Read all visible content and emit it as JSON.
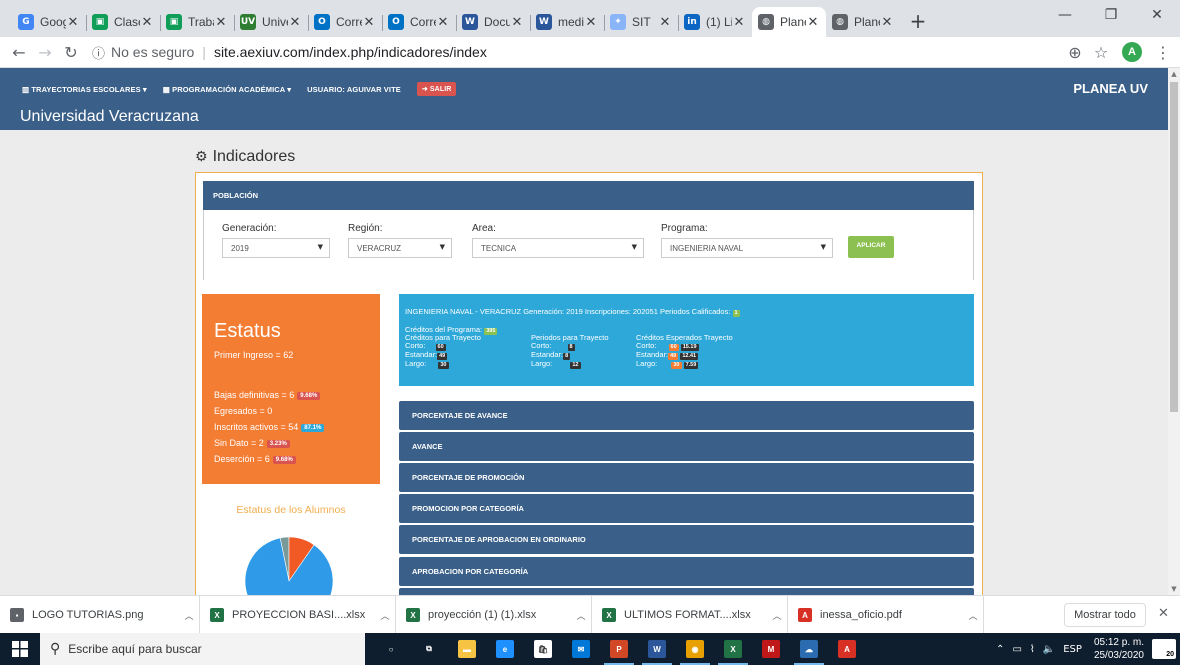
{
  "browser": {
    "tabs": [
      {
        "title": "Goog",
        "icon": "google-icon",
        "color": "#4285f4",
        "glyph": "G",
        "active": false
      },
      {
        "title": "Clase",
        "icon": "classroom-icon",
        "color": "#0f9d58",
        "glyph": "▣",
        "active": false
      },
      {
        "title": "Traba",
        "icon": "classroom-icon",
        "color": "#0f9d58",
        "glyph": "▣",
        "active": false
      },
      {
        "title": "Unive",
        "icon": "uv-icon",
        "color": "#2e7d32",
        "glyph": "UV",
        "active": false
      },
      {
        "title": "Corre",
        "icon": "outlook-icon",
        "color": "#0072c6",
        "glyph": "O",
        "active": false
      },
      {
        "title": "Corre",
        "icon": "outlook-icon",
        "color": "#0072c6",
        "glyph": "O",
        "active": false
      },
      {
        "title": "Docu",
        "icon": "word-icon",
        "color": "#2b579a",
        "glyph": "W",
        "active": false
      },
      {
        "title": "medi",
        "icon": "word-icon",
        "color": "#2b579a",
        "glyph": "W",
        "active": false
      },
      {
        "title": "SIT",
        "icon": "sit-icon",
        "color": "#8ab4f8",
        "glyph": "✦",
        "active": false
      },
      {
        "title": "(1) Lir",
        "icon": "linkedin-icon",
        "color": "#0a66c2",
        "glyph": "in",
        "active": false
      },
      {
        "title": "Plane",
        "icon": "globe-icon",
        "color": "#5f6368",
        "glyph": "◍",
        "active": true
      },
      {
        "title": "Plane",
        "icon": "globe-icon",
        "color": "#5f6368",
        "glyph": "◍",
        "active": false
      }
    ],
    "security_label": "No es seguro",
    "url": "site.aexiuv.com/index.php/indicadores/index",
    "profile_initial": "A"
  },
  "site": {
    "nav": {
      "trayectorias": "TRAYECTORIAS ESCOLARES",
      "programacion": "PROGRAMACIÓN ACADÉMICA",
      "usuario": "USUARIO: AGUIVAR VITE",
      "salir": "SALIR"
    },
    "title": "Universidad Veracruzana",
    "brand": "PLANEA UV"
  },
  "page": {
    "heading": "Indicadores",
    "poblacion_label": "POBLACIÓN",
    "filters": {
      "generacion_label": "Generación:",
      "generacion_value": "2019",
      "region_label": "Región:",
      "region_value": "VERACRUZ",
      "area_label": "Area:",
      "area_value": "TECNICA",
      "programa_label": "Programa:",
      "programa_value": "INGENIERIA NAVAL",
      "apply_label": "APLICAR"
    },
    "estatus": {
      "title": "Estatus",
      "primer_ingreso": "Primer Ingreso = 62",
      "bajas": "Bajas definitivas = 6",
      "bajas_pct": "9.68%",
      "egresados": "Egresados = 0",
      "inscritos": "Inscritos activos = 54",
      "inscritos_pct": "87.1%",
      "sin_dato": "Sin Dato = 2",
      "sin_dato_pct": "3.23%",
      "desercion": "Deserción = 6",
      "desercion_pct": "9.68%"
    },
    "alumnos_title": "Estatus de los Alumnos",
    "info": {
      "title": "INGENIERIA NAVAL - VERACRUZ Generación: 2019  Inscripciones: 202051  Periodos Calificados:",
      "periodos_calificados": "1",
      "creditos_programa_label": "Créditos del Programa:",
      "creditos_programa": "395",
      "creditos_trayecto_label": "Créditos para Trayecto",
      "periodos_trayecto_label": "Periodos para Trayecto",
      "creditos_esperados_label": "Créditos Esperados Trayecto",
      "corto": "Corto:",
      "estandar": "Estandar:",
      "largo": "Largo:",
      "ct_corto": "60",
      "ct_estandar": "49",
      "ct_largo": "30",
      "pt_corto": "8",
      "pt_estandar": "8",
      "pt_largo": "12",
      "ce_corto_a": "60",
      "ce_corto_b": "15.19",
      "ce_estandar_a": "49",
      "ce_estandar_b": "12.41",
      "ce_largo_a": "30",
      "ce_largo_b": "7.59"
    },
    "sections": [
      "PORCENTAJE DE AVANCE",
      "AVANCE",
      "PORCENTAJE DE PROMOCIÓN",
      "PROMOCION POR CATEGORÍA",
      "PORCENTAJE DE APROBACION EN ORDINARIO",
      "APROBACION POR CATEGORÍA"
    ]
  },
  "chart_data": {
    "type": "pie",
    "slices": [
      {
        "category": "Inscritos activos",
        "value": 87.1,
        "color": "#2e9ae8"
      },
      {
        "category": "Bajas definitivas",
        "value": 9.68,
        "color": "#f15a24"
      },
      {
        "category": "Sin Dato",
        "value": 3.23,
        "color": "#7a9a9a"
      }
    ]
  },
  "downloads": {
    "items": [
      {
        "name": "LOGO TUTORIAS.png",
        "icon": "image-file-icon",
        "color": "#5f6368",
        "glyph": "▪"
      },
      {
        "name": "PROYECCION BASI....xlsx",
        "icon": "excel-file-icon",
        "color": "#217346",
        "glyph": "X"
      },
      {
        "name": "proyección (1) (1).xlsx",
        "icon": "excel-file-icon",
        "color": "#217346",
        "glyph": "X"
      },
      {
        "name": "ULTIMOS FORMAT....xlsx",
        "icon": "excel-file-icon",
        "color": "#217346",
        "glyph": "X"
      },
      {
        "name": "inessa_oficio.pdf",
        "icon": "pdf-file-icon",
        "color": "#d93025",
        "glyph": "A"
      }
    ],
    "show_all": "Mostrar todo"
  },
  "taskbar": {
    "search_placeholder": "Escribe aquí para buscar",
    "apps": [
      {
        "name": "cortana-icon",
        "color": "transparent",
        "glyph": "○",
        "open": false
      },
      {
        "name": "task-view-icon",
        "color": "transparent",
        "glyph": "⧉",
        "open": false
      },
      {
        "name": "file-explorer-icon",
        "color": "#f6c343",
        "glyph": "▬",
        "open": false
      },
      {
        "name": "edge-icon",
        "color": "#1e90ff",
        "glyph": "e",
        "open": false
      },
      {
        "name": "store-icon",
        "color": "#ffffff",
        "glyph": "🛍",
        "open": false
      },
      {
        "name": "mail-icon",
        "color": "#0078d7",
        "glyph": "✉",
        "open": false
      },
      {
        "name": "powerpoint-icon",
        "color": "#d24726",
        "glyph": "P",
        "open": true
      },
      {
        "name": "word-icon",
        "color": "#2b579a",
        "glyph": "W",
        "open": true
      },
      {
        "name": "chrome-icon",
        "color": "#e8a000",
        "glyph": "◉",
        "open": true
      },
      {
        "name": "excel-icon",
        "color": "#217346",
        "glyph": "X",
        "open": true
      },
      {
        "name": "mcafee-icon",
        "color": "#c01818",
        "glyph": "M",
        "open": false
      },
      {
        "name": "cloud-app-icon",
        "color": "#2b6bb0",
        "glyph": "☁",
        "open": true
      },
      {
        "name": "acrobat-icon",
        "color": "#d93025",
        "glyph": "A",
        "open": false
      }
    ],
    "language": "ESP",
    "time": "05:12 p. m.",
    "date": "25/03/2020",
    "notifications": "20"
  }
}
